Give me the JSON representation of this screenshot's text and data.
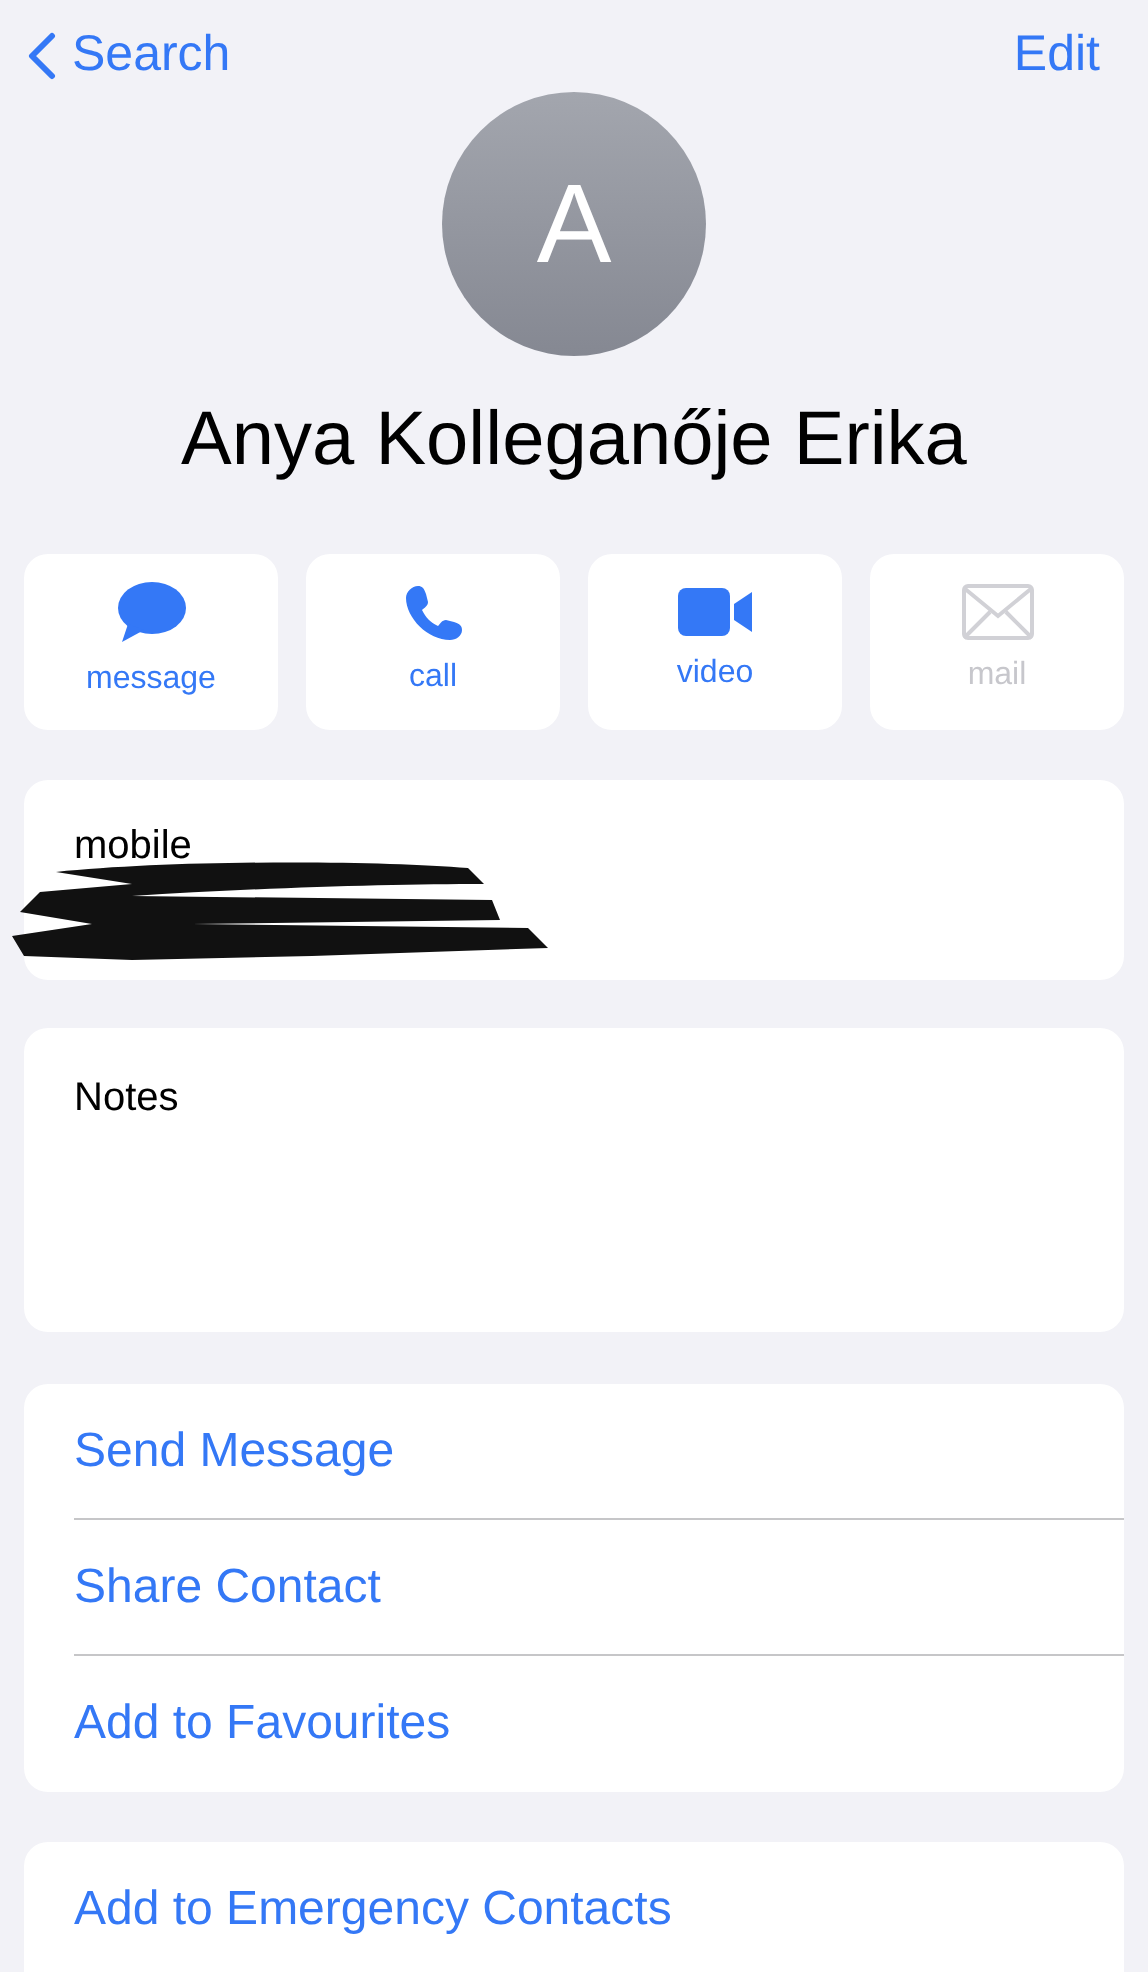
{
  "nav": {
    "back_label": "Search",
    "edit_label": "Edit"
  },
  "avatar": {
    "initial": "A"
  },
  "name": "Anya Kolleganője Erika",
  "actions": [
    {
      "kind": "message",
      "label": "message",
      "disabled": false
    },
    {
      "kind": "call",
      "label": "call",
      "disabled": false
    },
    {
      "kind": "video",
      "label": "video",
      "disabled": false
    },
    {
      "kind": "mail",
      "label": "mail",
      "disabled": true
    }
  ],
  "phone": {
    "label": "mobile",
    "redacted": true
  },
  "notes": {
    "label": "Notes"
  },
  "links": [
    "Send Message",
    "Share Contact",
    "Add to Favourites"
  ],
  "emergency": {
    "label": "Add to Emergency Contacts"
  }
}
